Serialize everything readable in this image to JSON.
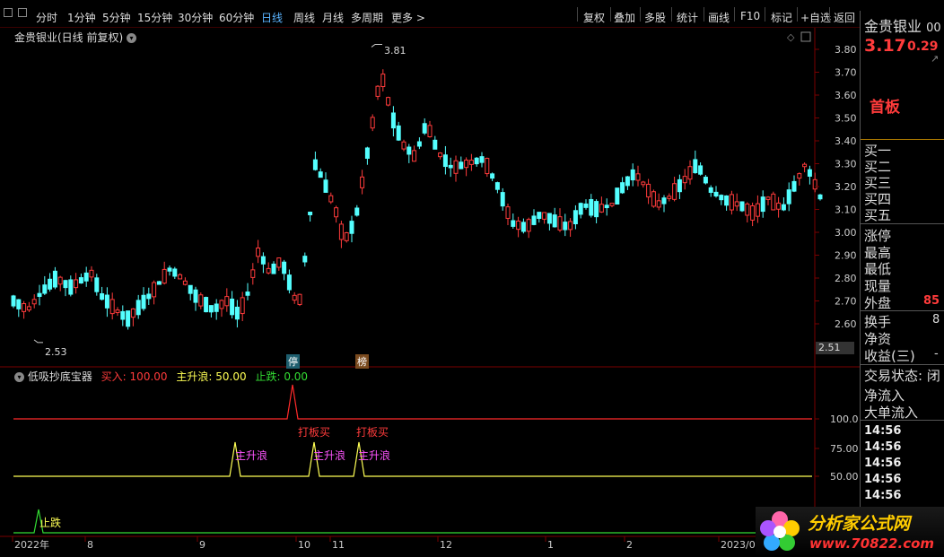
{
  "toolbar": {
    "periods": [
      "分时",
      "1分钟",
      "5分钟",
      "15分钟",
      "30分钟",
      "60分钟",
      "日线",
      "周线",
      "月线",
      "多周期",
      "更多 >"
    ],
    "active_period": "日线",
    "buttons": [
      "复权",
      "叠加",
      "多股",
      "统计",
      "画线",
      "F10",
      "标记",
      "+自选",
      "返回"
    ]
  },
  "chart": {
    "title": "金贵银业(日线 前复权)",
    "y_ticks": [
      "3.80",
      "3.70",
      "3.60",
      "3.50",
      "3.40",
      "3.30",
      "3.20",
      "3.10",
      "3.00",
      "2.90",
      "2.80",
      "2.70",
      "2.60"
    ],
    "current_price_tag": "2.51",
    "high_annotation": "3.81",
    "low_annotation": "2.53",
    "event_tag_limit": "停",
    "event_tag_board": "榜",
    "colors": {
      "up": "#ff3b3b",
      "down": "#54ffff",
      "grid": "#7a0000"
    }
  },
  "indicator": {
    "name": "低吸抄底宝器",
    "buy_label": "买入:",
    "buy_value": "100.00",
    "wave_label": "主升浪:",
    "wave_value": "50.00",
    "stop_label": "止跌:",
    "stop_value": "0.00",
    "y_ticks": [
      "100.0",
      "75.00",
      "50.00"
    ],
    "signal_buy": "打板买",
    "signal_wave": "主升浪",
    "signal_stop": "止跌"
  },
  "x_axis": [
    "2022年",
    "8",
    "9",
    "10",
    "11",
    "12",
    "1",
    "2",
    "2023/0"
  ],
  "quote_panel": {
    "stock_name": "金贵银业",
    "stock_code_frag": "00",
    "price": "3.17",
    "change": "0.29",
    "tag": "首板",
    "bids": [
      "买一",
      "买二",
      "买三",
      "买四",
      "买五"
    ],
    "stats": [
      "涨停",
      "最高",
      "最低",
      "现量",
      "外盘"
    ],
    "outer_value": "85",
    "more_stats": [
      "换手",
      "净资",
      "收益(三)"
    ],
    "turnover_frag": "8",
    "earnings_frag": "-",
    "trade_status": "交易状态: 闭",
    "net_inflow": "净流入",
    "big_inflow": "大单流入",
    "times": [
      "14:56",
      "14:56",
      "14:56",
      "14:56",
      "14:56"
    ]
  },
  "logo": {
    "name": "分析家公式网",
    "url": "www.70822.com"
  }
}
